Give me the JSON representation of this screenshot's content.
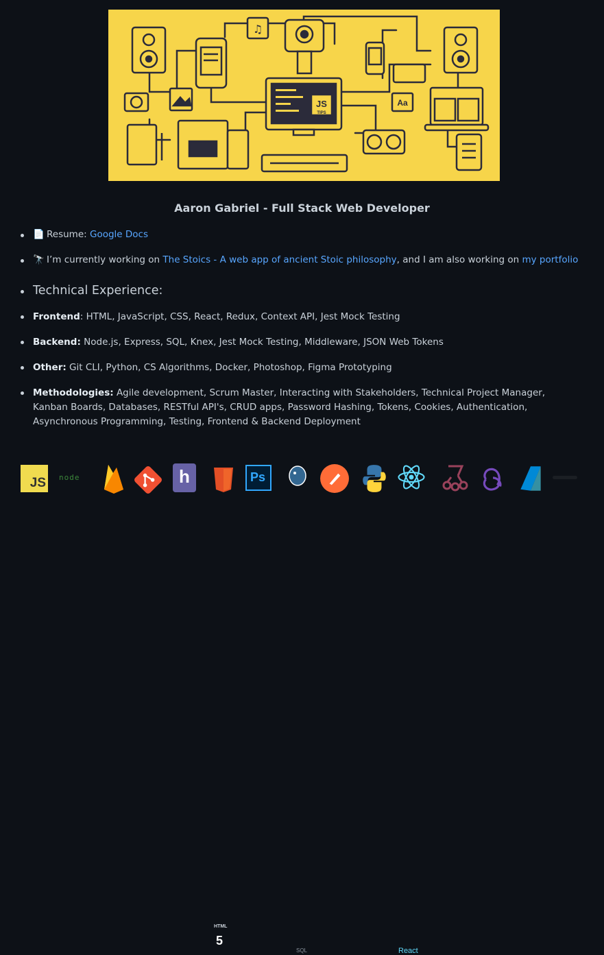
{
  "profile": {
    "name_heading": "Aaron Gabriel - Full Stack Web Developer"
  },
  "banner": {
    "badge_text": "JS",
    "badge_sub": "TIPS",
    "font_sample": "Aa"
  },
  "links": {
    "resume_label": "Resume:",
    "resume_link": "Google Docs",
    "working_prefix": "I’m currently working on",
    "working_link": "The Stoics - A web app of ancient Stoic philosophy",
    "working_middle": ", and I am also working on",
    "portfolio_link": "my portfolio",
    "doc_emoji": "📄",
    "scope_emoji": "🔭"
  },
  "tech": {
    "heading": "Technical Experience:",
    "items": [
      {
        "label": "Frontend",
        "text": ": HTML, JavaScript, CSS, React, Redux, Context API, Jest Mock Testing"
      },
      {
        "label": "Backend:",
        "text": " Node.js, Express, SQL, Knex, Jest Mock Testing, Middleware, JSON Web Tokens"
      },
      {
        "label": "Other:",
        "text": " Git CLI, Python, CS Algorithms, Docker, Photoshop, Figma Prototyping"
      },
      {
        "label": "Methodologies:",
        "text": " Agile development, Scrum Master, Interacting with Stakeholders, Technical Project Manager, Kanban Boards, Databases, RESTful API's, CRUD apps, Password Hashing, Tokens, Cookies, Authentication, Asynchronous Programming, Testing, Frontend & Backend Deployment"
      }
    ]
  },
  "tool_icons": {
    "js": "JS",
    "node": "node",
    "html5": "HTML",
    "html5_num": "5",
    "ps": "Ps",
    "sql": "SQL",
    "react": "React",
    "heroku": "h"
  },
  "colors": {
    "background": "#0d1117",
    "text": "#c9d1d9",
    "link": "#58a6ff",
    "banner": "#f7d54a"
  }
}
